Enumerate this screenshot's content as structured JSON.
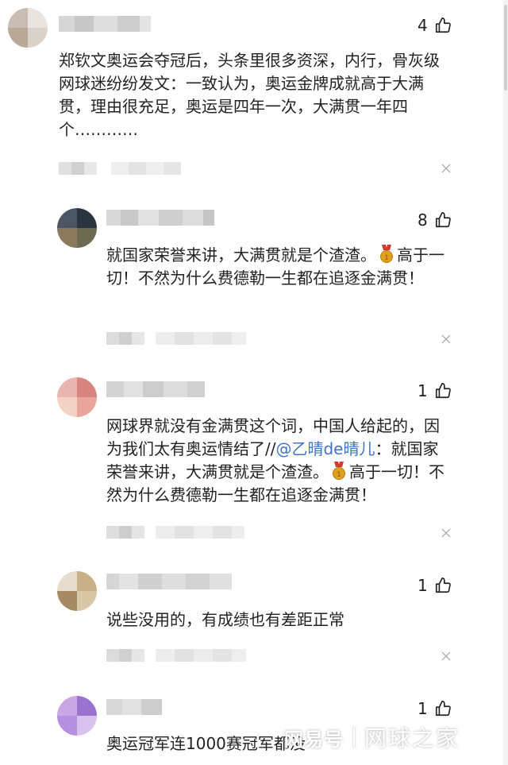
{
  "icons": {
    "like": "thumbs-up-icon",
    "close": "close-icon",
    "medal": "gold-medal-icon"
  },
  "colors": {
    "mention": "#4273c9",
    "medal": "#e0a021"
  },
  "comments": [
    {
      "likes": "4",
      "text": "郑钦文奥运会夺冠后，头条里很多资深，内行，骨灰级网球迷纷纷发文：一致认为，奥运金牌成就高于大满贯，理由很充足，奥运是四年一次，大满贯一年四个…………"
    },
    {
      "likes": "8",
      "text_a": "就国家荣誉来讲，大满贯就是个渣渣。",
      "text_b": "高于一切！不然为什么费德勒一生都在追逐金满贯！"
    },
    {
      "likes": "1",
      "text_a": "网球界就没有金满贯这个词，中国人给起的，因为我们太有奥运情结了//",
      "mention": "@乙晴de晴儿",
      "text_b": "：就国家荣誉来讲，大满贯就是个渣渣。",
      "text_c": "高于一切！不然为什么费德勒一生都在追逐金满贯！"
    },
    {
      "likes": "1",
      "text": "说些没用的，有成绩也有差距正常"
    },
    {
      "likes": "1",
      "text": "奥运冠军连1000赛冠军都没"
    }
  ],
  "watermark": {
    "logo": "网易号",
    "name": "网球之家"
  }
}
